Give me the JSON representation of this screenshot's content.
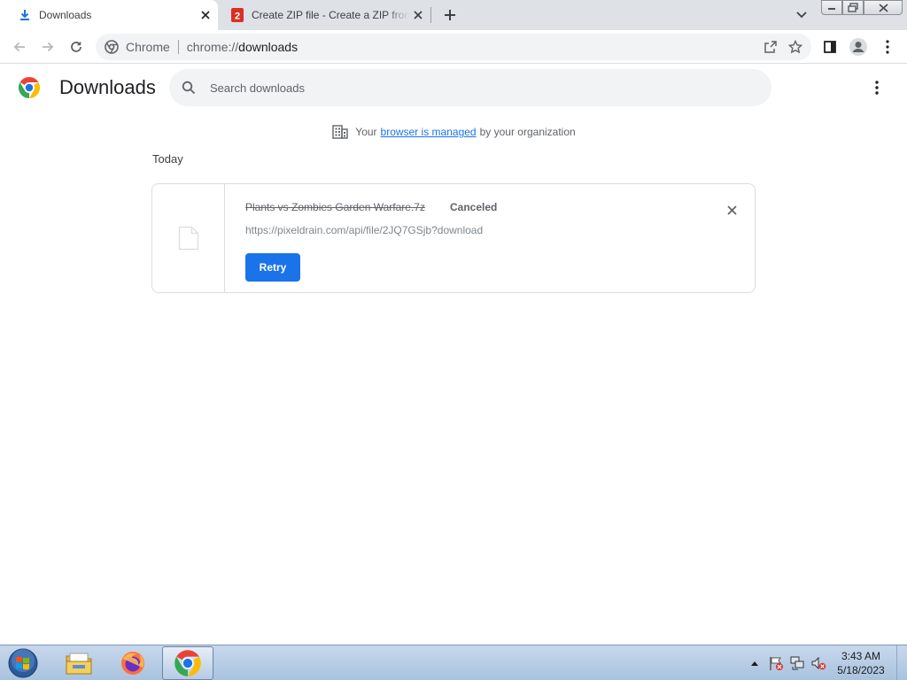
{
  "tabs": [
    {
      "title": "Downloads",
      "icon": "download-icon",
      "active": true
    },
    {
      "title": "Create ZIP file - Create a ZIP from",
      "icon": "zip-favicon-icon",
      "active": false
    }
  ],
  "toolbar": {
    "origin": "Chrome",
    "url_scheme": "chrome://",
    "url_host": "downloads"
  },
  "downloads": {
    "title": "Downloads",
    "search_placeholder": "Search downloads",
    "managed_prefix": "Your",
    "managed_link": "browser is managed",
    "managed_suffix": "by your organization",
    "date_heading": "Today",
    "items": [
      {
        "file_name": "Plants vs Zombies Garden Warfare.7z",
        "status": "Canceled",
        "url": "https://pixeldrain.com/api/file/2JQ7GSjb?download",
        "action_label": "Retry"
      }
    ]
  },
  "taskbar": {
    "time": "3:43 AM",
    "date": "5/18/2023"
  },
  "colors": {
    "accent": "#1a73e8",
    "tabstrip": "#dee1e6",
    "taskbar": "#b7cbe3"
  }
}
